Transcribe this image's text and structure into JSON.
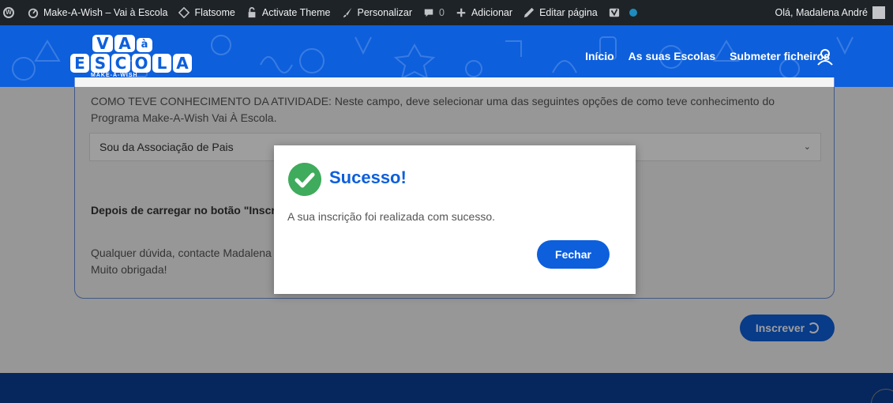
{
  "adminbar": {
    "site_name": "Make-A-Wish – Vai à Escola",
    "theme": "Flatsome",
    "activate": "Activate Theme",
    "customize": "Personalizar",
    "comments_count": "0",
    "add_new": "Adicionar",
    "edit_page": "Editar página",
    "greeting": "Olá, Madalena André"
  },
  "logo": {
    "tiles_top": [
      "V",
      "A",
      "à"
    ],
    "tiles_bottom": [
      "E",
      "S",
      "C",
      "O",
      "L",
      "A"
    ],
    "subtitle": "MAKE-A-WISH"
  },
  "nav": {
    "items": [
      "Início",
      "As suas Escolas",
      "Submeter ficheiros"
    ]
  },
  "form": {
    "help_text": "COMO TEVE CONHECIMENTO DA ATIVIDADE: Neste campo, deve selecionar uma das seguintes opções de como teve conhecimento do Programa Make-A-Wish Vai À Escola.",
    "select_value": "Sou da Associação de Pais",
    "after_text": "Depois de carregar no botão \"Inscre",
    "contact_line1": "Qualquer dúvida, contacte Madalena",
    "contact_line2": "Muito obrigada!",
    "submit_label": "Inscrever"
  },
  "modal": {
    "title": "Sucesso!",
    "message": "A sua inscrição foi realizada com sucesso.",
    "close_label": "Fechar"
  },
  "colors": {
    "brand_blue": "#0d5fdc",
    "success_green": "#3fab5c",
    "admin_bar": "#1d2327"
  }
}
